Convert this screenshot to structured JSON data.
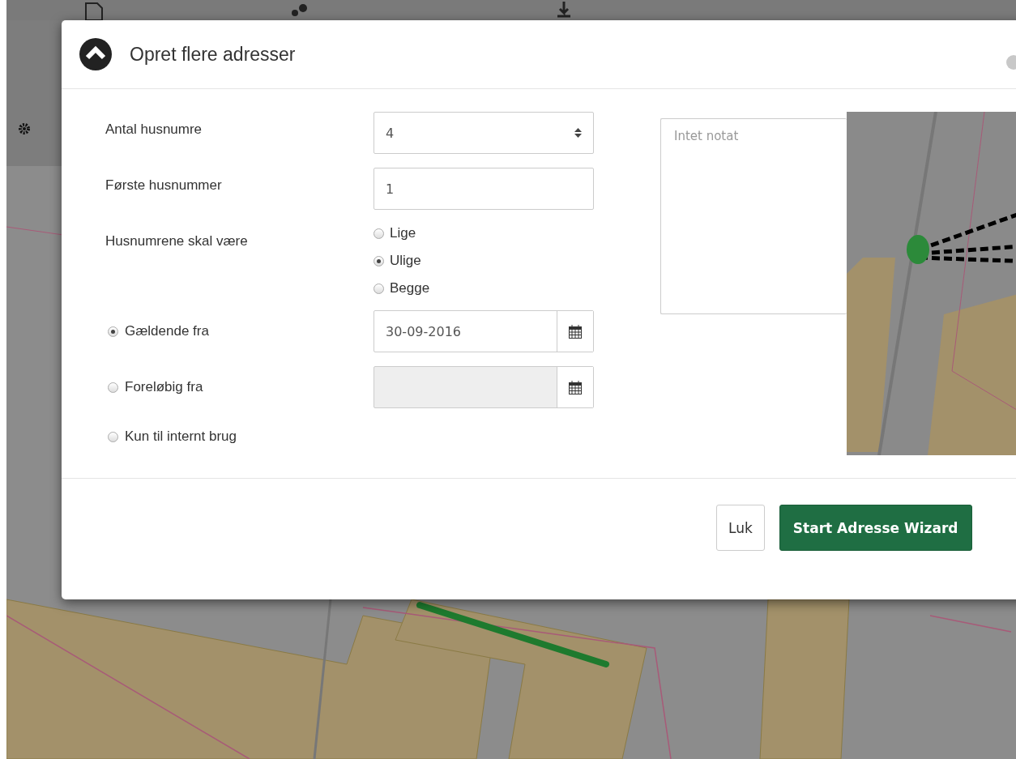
{
  "dialog": {
    "title": "Opret flere adresser",
    "fields": [
      {
        "kind": "spinner",
        "label": "Antal husnumre",
        "value": "4"
      },
      {
        "kind": "text",
        "label": "Første husnummer",
        "value": "1"
      },
      {
        "kind": "radios",
        "label": "Husnumrene skal være",
        "options": [
          {
            "label": "Lige",
            "selected": false
          },
          {
            "label": "Ulige",
            "selected": true
          },
          {
            "label": "Begge",
            "selected": false
          }
        ]
      }
    ],
    "validity": [
      {
        "kind": "date",
        "label": "Gældende fra",
        "selected": true,
        "value": "30-09-2016",
        "disabled": false
      },
      {
        "kind": "date",
        "label": "Foreløbig fra",
        "selected": false,
        "disabled": true
      },
      {
        "kind": "plain",
        "label": "Kun til internt brug",
        "selected": false
      }
    ],
    "note": {
      "placeholder": "Intet notat"
    },
    "buttons": [
      {
        "kind": "default",
        "label": "Luk"
      },
      {
        "kind": "primary",
        "label": "Start Adresse Wizard"
      }
    ]
  }
}
